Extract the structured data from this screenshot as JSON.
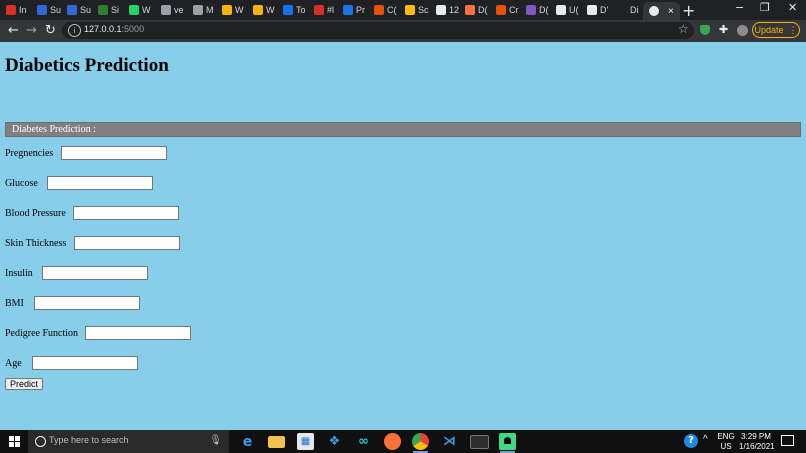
{
  "browser": {
    "tabs": [
      {
        "label": "In",
        "color": "#d93025"
      },
      {
        "label": "Su",
        "color": "#3367d6"
      },
      {
        "label": "Su",
        "color": "#3367d6"
      },
      {
        "label": "Si",
        "color": "#2e7d32"
      },
      {
        "label": "W",
        "color": "#25d366"
      },
      {
        "label": "ve",
        "color": "#9aa0a6"
      },
      {
        "label": "M",
        "color": "#9aa0a6"
      },
      {
        "label": "W",
        "color": "#f4b400"
      },
      {
        "label": "W",
        "color": "#f4b400"
      },
      {
        "label": "To",
        "color": "#1a73e8"
      },
      {
        "label": "#l",
        "color": "#d93025"
      },
      {
        "label": "Pr",
        "color": "#1a73e8"
      },
      {
        "label": "C(",
        "color": "#e65100"
      },
      {
        "label": "Sc",
        "color": "#fbbc04"
      },
      {
        "label": "12",
        "color": "#e8eaed"
      },
      {
        "label": "D(",
        "color": "#ff7043"
      },
      {
        "label": "Cr",
        "color": "#e65100"
      },
      {
        "label": "D(",
        "color": "#7e57c2"
      },
      {
        "label": "U(",
        "color": "#e8eaed"
      },
      {
        "label": "D'",
        "color": "#e8eaed"
      },
      {
        "label": "Di",
        "color": "#202124"
      }
    ],
    "active_tab": {
      "label": "D(",
      "close": "×"
    },
    "new_tab": "+",
    "window_controls": [
      "−",
      "❐",
      "✕"
    ],
    "url_host": "127.0.0.1",
    "url_port": ":5000",
    "update_label": "Update"
  },
  "page": {
    "title": "Diabetics Prediction",
    "section_header": "Diabetes Prediction :",
    "fields": [
      {
        "label": "Pregnencies",
        "value": ""
      },
      {
        "label": "Glucose",
        "value": ""
      },
      {
        "label": "Blood Pressure",
        "value": ""
      },
      {
        "label": "Skin Thickness",
        "value": ""
      },
      {
        "label": "Insulin",
        "value": ""
      },
      {
        "label": "BMI",
        "value": ""
      },
      {
        "label": "Pedigree Function",
        "value": ""
      },
      {
        "label": "Age",
        "value": ""
      }
    ],
    "predict_label": "Predict"
  },
  "taskbar": {
    "search_placeholder": "Type here to search",
    "apps": [
      "edge-icon",
      "file-explorer-icon",
      "store-icon",
      "dropbox-icon",
      "infinity-icon",
      "firefox-icon",
      "chrome-icon",
      "vscode-icon",
      "terminal-icon",
      "android-studio-icon"
    ],
    "lang_top": "ENG",
    "lang_bottom": "US",
    "time": "3:29 PM",
    "date": "1/16/2021"
  }
}
